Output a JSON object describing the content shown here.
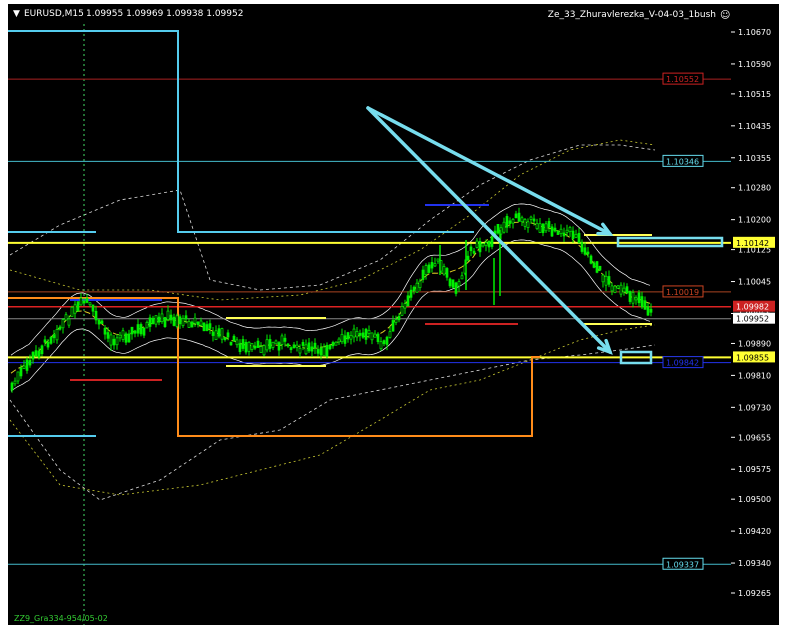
{
  "header": {
    "symbol": "EURUSD,M15",
    "ohlc": "1.09955 1.09969 1.09938 1.09952",
    "indicator": "Ze_33_Zhuravlerezka_V-04-03_1bush",
    "smiley": "☺"
  },
  "footer": {
    "text": "ZZ9_Gra334-954/05-02"
  },
  "colors": {
    "background": "#000000",
    "candle": "#00ff00",
    "yellow": "#ffff33",
    "cyan": "#66ddee",
    "orange": "#ff8c1a",
    "red": "#cc2222",
    "blue": "#2233ee"
  },
  "chart_data": {
    "type": "candlestick",
    "symbol": "EURUSD",
    "timeframe": "M15",
    "ylim": [
      1.092,
      1.1072
    ],
    "price_axis_ticks": [
      "1.10670",
      "1.10590",
      "1.10515",
      "1.10435",
      "1.10355",
      "1.10280",
      "1.10200",
      "1.10125",
      "1.10045",
      "1.09965",
      "1.09890",
      "1.09810",
      "1.09730",
      "1.09655",
      "1.09575",
      "1.09500",
      "1.09420",
      "1.09340",
      "1.09265"
    ],
    "tick_values": [
      1.1067,
      1.1059,
      1.10515,
      1.10435,
      1.10355,
      1.1028,
      1.102,
      1.10125,
      1.10045,
      1.09965,
      1.0989,
      1.0981,
      1.0973,
      1.09655,
      1.09575,
      1.095,
      1.0942,
      1.0934,
      1.09265
    ],
    "levels": [
      {
        "label": "1.10552",
        "value": 1.10552,
        "color": "#cc2222",
        "badge": "outline"
      },
      {
        "label": "1.10346",
        "value": 1.10346,
        "color": "#66ddee",
        "badge": "outline"
      },
      {
        "label": "1.10142",
        "value": 1.10142,
        "color": "#ffff33",
        "badge": "filled"
      },
      {
        "label": "1.10019",
        "value": 1.10019,
        "color": "#cc4422",
        "badge": "outline"
      },
      {
        "label": "1.09982",
        "value": 1.09982,
        "color": "#cc2222",
        "badge": "filled"
      },
      {
        "label": "1.09952",
        "value": 1.09952,
        "color": "#ffffff",
        "badge": "filled"
      },
      {
        "label": "1.09855",
        "value": 1.09855,
        "color": "#ffff33",
        "badge": "filled"
      },
      {
        "label": "1.09842",
        "value": 1.09842,
        "color": "#2233ee",
        "badge": "outline"
      },
      {
        "label": "1.09337",
        "value": 1.09337,
        "color": "#66ddee",
        "badge": "outline"
      }
    ],
    "last_price": 1.09952
  }
}
